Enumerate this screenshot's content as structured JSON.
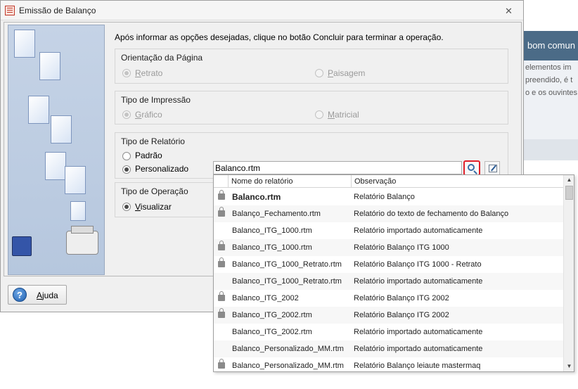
{
  "background_page": {
    "banner": "bom comun",
    "lines": [
      "elementos im",
      "preendido, é t",
      "o e os ouvintes"
    ]
  },
  "dialog": {
    "title": "Emissão de Balanço",
    "title_icon": "calculator-icon",
    "close_icon": "close-icon",
    "instruction": "Após informar as opções desejadas, clique no botão Concluir para terminar a operação.",
    "orientation": {
      "title": "Orientação da Página",
      "options": [
        {
          "label": "Retrato",
          "checked": true,
          "enabled": false
        },
        {
          "label": "Paisagem",
          "checked": false,
          "enabled": false
        }
      ]
    },
    "print_type": {
      "title": "Tipo de Impressão",
      "options": [
        {
          "label": "Gráfico",
          "checked": true,
          "enabled": false
        },
        {
          "label": "Matricial",
          "checked": false,
          "enabled": false
        }
      ]
    },
    "report_type": {
      "title": "Tipo de Relatório",
      "options": [
        {
          "label": "Padrão",
          "checked": false,
          "enabled": true
        },
        {
          "label": "Personalizado",
          "checked": true,
          "enabled": true
        }
      ],
      "input_value": "Balanco.rtm"
    },
    "operation_type": {
      "title": "Tipo de Operação",
      "options": [
        {
          "label": "Visualizar",
          "checked": true,
          "enabled": true
        }
      ]
    },
    "help_button": "Ajuda"
  },
  "dropdown": {
    "columns": [
      "Nome do relatório",
      "Observação"
    ],
    "rows": [
      {
        "name": "Balanco.rtm",
        "note": "Relatório Balanço",
        "locked": true,
        "bold": true
      },
      {
        "name": "Balanço_Fechamento.rtm",
        "note": "Relatório do texto de fechamento do Balanço",
        "locked": true,
        "bold": false
      },
      {
        "name": "Balanco_ITG_1000.rtm",
        "note": "Relatório importado automaticamente",
        "locked": false,
        "bold": false
      },
      {
        "name": "Balanco_ITG_1000.rtm",
        "note": "Relatório Balanço ITG 1000",
        "locked": true,
        "bold": false
      },
      {
        "name": "Balanco_ITG_1000_Retrato.rtm",
        "note": "Relatório Balanço ITG 1000 - Retrato",
        "locked": true,
        "bold": false
      },
      {
        "name": "Balanco_ITG_1000_Retrato.rtm",
        "note": "Relatório importado automaticamente",
        "locked": false,
        "bold": false
      },
      {
        "name": "Balanco_ITG_2002",
        "note": "Relatório Balanço ITG 2002",
        "locked": true,
        "bold": false
      },
      {
        "name": "Balanco_ITG_2002.rtm",
        "note": "Relatório Balanço ITG 2002",
        "locked": true,
        "bold": false
      },
      {
        "name": "Balanco_ITG_2002.rtm",
        "note": "Relatório importado automaticamente",
        "locked": false,
        "bold": false
      },
      {
        "name": "Balanco_Personalizado_MM.rtm",
        "note": "Relatório importado automaticamente",
        "locked": false,
        "bold": false
      },
      {
        "name": "Balanco_Personalizado_MM.rtm",
        "note": "Relatório Balanço leiaute mastermaq",
        "locked": true,
        "bold": false
      }
    ]
  }
}
